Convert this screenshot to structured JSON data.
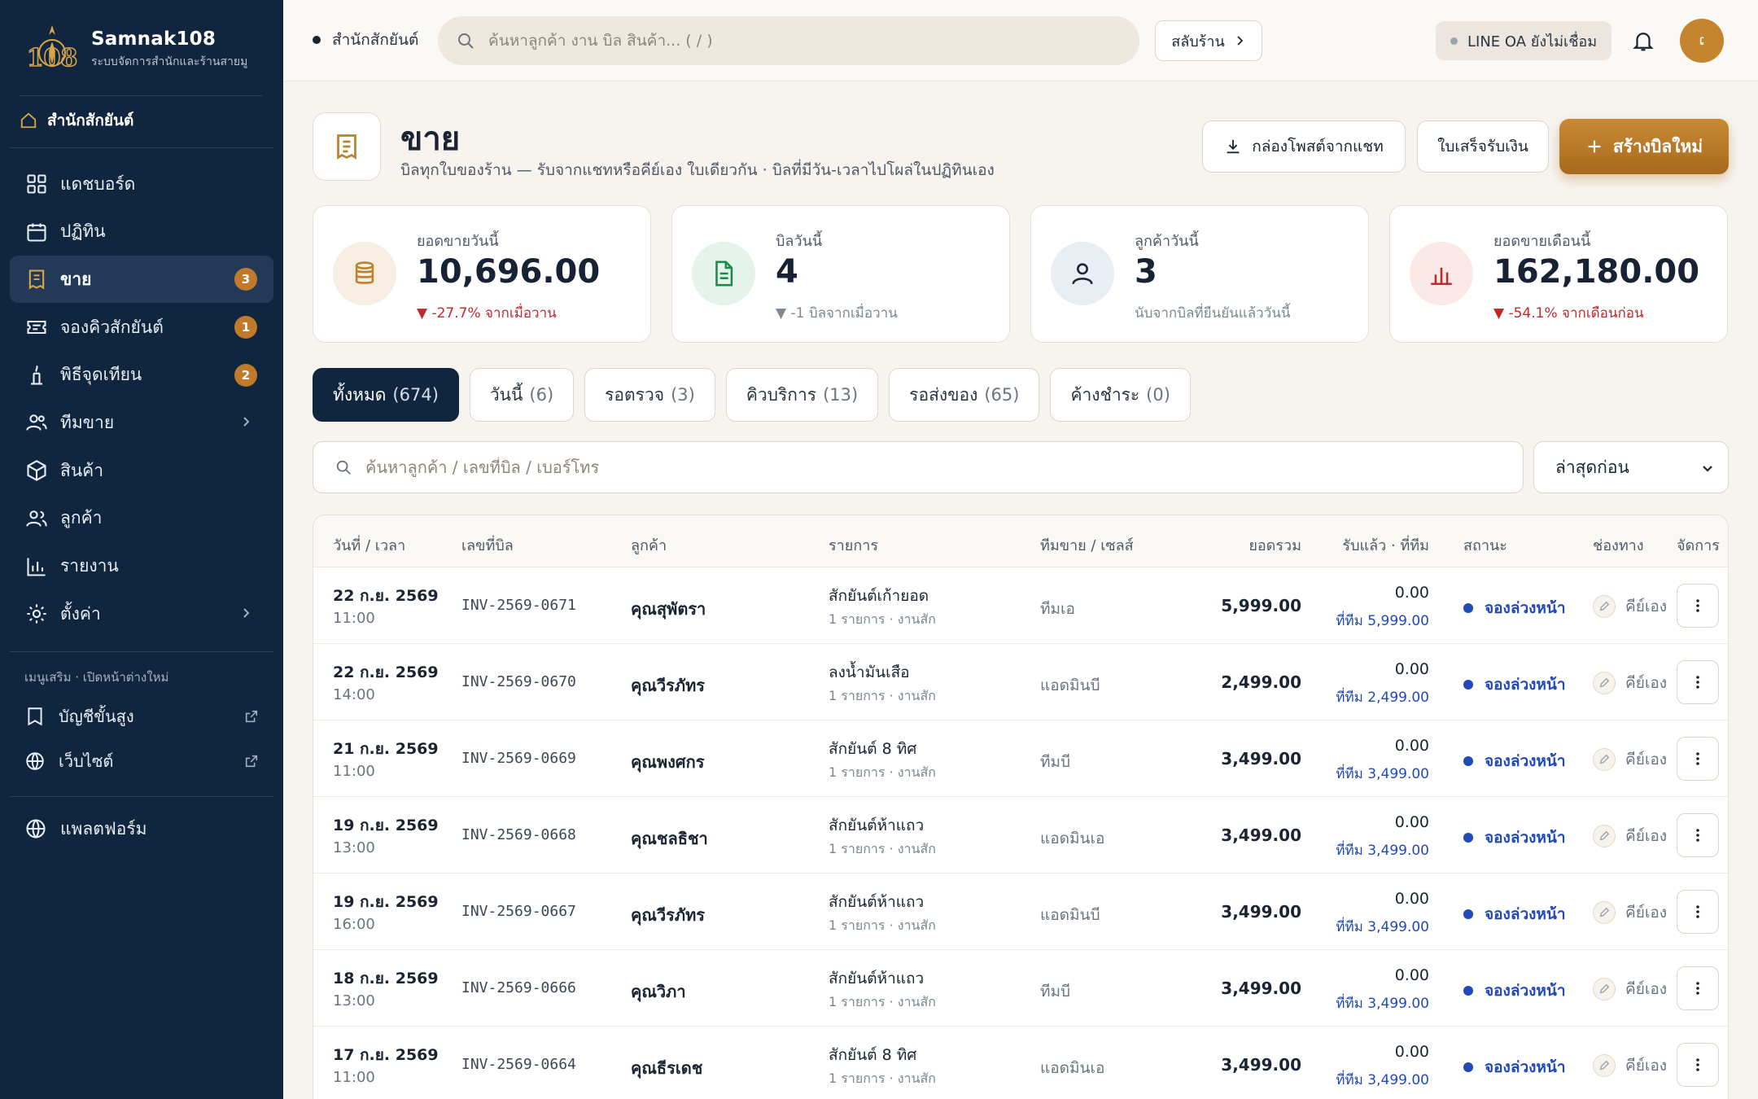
{
  "brand": {
    "name": "Samnak108",
    "subtitle": "ระบบจัดการสำนักและร้านสายมู",
    "logo_text": "108"
  },
  "sidebar": {
    "shop": "สำนักสักยันต์",
    "items": [
      {
        "label": "แดชบอร์ด",
        "icon": "dashboard-icon"
      },
      {
        "label": "ปฏิทิน",
        "icon": "calendar-icon"
      },
      {
        "label": "ขาย",
        "icon": "receipt-icon",
        "badge": "3",
        "active": true
      },
      {
        "label": "จองคิวสักยันต์",
        "icon": "ticket-icon",
        "badge": "1"
      },
      {
        "label": "พิธีจุดเทียน",
        "icon": "candle-icon",
        "badge": "2"
      },
      {
        "label": "ทีมขาย",
        "icon": "team-icon"
      },
      {
        "label": "สินค้า",
        "icon": "box-icon"
      },
      {
        "label": "ลูกค้า",
        "icon": "customers-icon"
      },
      {
        "label": "รายงาน",
        "icon": "chart-icon"
      },
      {
        "label": "ตั้งค่า",
        "icon": "settings-icon"
      }
    ],
    "section_label": "เมนูเสริม · เปิดหน้าต่างใหม่",
    "external": [
      {
        "label": "บัญชีขั้นสูง",
        "icon": "book-icon"
      },
      {
        "label": "เว็บไซต์",
        "icon": "globe-icon"
      }
    ],
    "platform": "แพลตฟอร์ม"
  },
  "topbar": {
    "breadcrumb": "สำนักสักยันต์",
    "search_placeholder": "ค้นหาลูกค้า งาน บิล สินค้า... ( / )",
    "switch_label": "สลับร้าน",
    "line_status": "LINE OA ยังไม่เชื่อม",
    "avatar_initial": "ເ"
  },
  "page": {
    "title": "ขาย",
    "subtitle": "บิลทุกใบของร้าน — รับจากแชทหรือคีย์เอง ใบเดียวกัน · บิลที่มีวัน-เวลาไปโผล่ในปฏิทินเอง",
    "btn_inbox": "กล่องโพสต์จากแชท",
    "btn_receipt": "ใบเสร็จรับเงิน",
    "btn_create": "สร้างบิลใหม่"
  },
  "stats": [
    {
      "label": "ยอดขายวันนี้",
      "value": "10,696.00",
      "delta": "▼ -27.7% จากเมื่อวาน",
      "trend": "down",
      "color": "#b8832e",
      "bg": "#f6eee1"
    },
    {
      "label": "บิลวันนี้",
      "value": "4",
      "delta": "▼ -1 บิลจากเมื่อวาน",
      "trend": "muted",
      "color": "#1e8a4a",
      "bg": "#e6f3ea"
    },
    {
      "label": "ลูกค้าวันนี้",
      "value": "3",
      "delta": "นับจากบิลที่ยืนยันแล้ววันนี้",
      "trend": "muted",
      "color": "#1b2433",
      "bg": "#e9eef5"
    },
    {
      "label": "ยอดขายเดือนนี้",
      "value": "162,180.00",
      "delta": "▼ -54.1% จากเดือนก่อน",
      "trend": "down",
      "color": "#c0282c",
      "bg": "#fbe9e8"
    }
  ],
  "tabs": [
    {
      "label": "ทั้งหมด",
      "count": "(674)",
      "active": true
    },
    {
      "label": "วันนี้",
      "count": "(6)"
    },
    {
      "label": "รอตรวจ",
      "count": "(3)"
    },
    {
      "label": "คิวบริการ",
      "count": "(13)"
    },
    {
      "label": "รอส่งของ",
      "count": "(65)"
    },
    {
      "label": "ค้างชำระ",
      "count": "(0)"
    }
  ],
  "filter": {
    "search_placeholder": "ค้นหาลูกค้า / เลขที่บิล / เบอร์โทร",
    "sort": "ล่าสุดก่อน"
  },
  "table": {
    "columns": [
      "วันที่ / เวลา",
      "เลขที่บิล",
      "ลูกค้า",
      "รายการ",
      "ทีมขาย / เซลส์",
      "ยอดรวม",
      "รับแล้ว · ที่ทีม",
      "สถานะ",
      "ช่องทาง",
      "จัดการ"
    ],
    "rows": [
      {
        "date": "22 ก.ย. 2569",
        "time": "11:00",
        "inv": "INV-2569-0671",
        "customer": "คุณสุพัตรา",
        "item": "สักยันต์เก้ายอด",
        "item_sub": "1 รายการ · งานสัก",
        "team": "ทีมเอ",
        "total": "5,999.00",
        "received": "0.00",
        "at_team": "ที่ทีม 5,999.00",
        "status": "จองล่วงหน้า",
        "channel": "คีย์เอง"
      },
      {
        "date": "22 ก.ย. 2569",
        "time": "14:00",
        "inv": "INV-2569-0670",
        "customer": "คุณวีรภัทร",
        "item": "ลงน้ำมันเสือ",
        "item_sub": "1 รายการ · งานสัก",
        "team": "แอดมินบี",
        "total": "2,499.00",
        "received": "0.00",
        "at_team": "ที่ทีม 2,499.00",
        "status": "จองล่วงหน้า",
        "channel": "คีย์เอง"
      },
      {
        "date": "21 ก.ย. 2569",
        "time": "11:00",
        "inv": "INV-2569-0669",
        "customer": "คุณพงศกร",
        "item": "สักยันต์ 8 ทิศ",
        "item_sub": "1 รายการ · งานสัก",
        "team": "ทีมบี",
        "total": "3,499.00",
        "received": "0.00",
        "at_team": "ที่ทีม 3,499.00",
        "status": "จองล่วงหน้า",
        "channel": "คีย์เอง"
      },
      {
        "date": "19 ก.ย. 2569",
        "time": "13:00",
        "inv": "INV-2569-0668",
        "customer": "คุณชลธิชา",
        "item": "สักยันต์ห้าแถว",
        "item_sub": "1 รายการ · งานสัก",
        "team": "แอดมินเอ",
        "total": "3,499.00",
        "received": "0.00",
        "at_team": "ที่ทีม 3,499.00",
        "status": "จองล่วงหน้า",
        "channel": "คีย์เอง"
      },
      {
        "date": "19 ก.ย. 2569",
        "time": "16:00",
        "inv": "INV-2569-0667",
        "customer": "คุณวีรภัทร",
        "item": "สักยันต์ห้าแถว",
        "item_sub": "1 รายการ · งานสัก",
        "team": "แอดมินบี",
        "total": "3,499.00",
        "received": "0.00",
        "at_team": "ที่ทีม 3,499.00",
        "status": "จองล่วงหน้า",
        "channel": "คีย์เอง"
      },
      {
        "date": "18 ก.ย. 2569",
        "time": "13:00",
        "inv": "INV-2569-0666",
        "customer": "คุณวิภา",
        "item": "สักยันต์ห้าแถว",
        "item_sub": "1 รายการ · งานสัก",
        "team": "ทีมบี",
        "total": "3,499.00",
        "received": "0.00",
        "at_team": "ที่ทีม 3,499.00",
        "status": "จองล่วงหน้า",
        "channel": "คีย์เอง"
      },
      {
        "date": "17 ก.ย. 2569",
        "time": "11:00",
        "inv": "INV-2569-0664",
        "customer": "คุณธีรเดช",
        "item": "สักยันต์ 8 ทิศ",
        "item_sub": "1 รายการ · งานสัก",
        "team": "แอดมินเอ",
        "total": "3,499.00",
        "received": "0.00",
        "at_team": "ที่ทีม 3,499.00",
        "status": "จองล่วงหน้า",
        "channel": "คีย์เอง"
      }
    ]
  }
}
